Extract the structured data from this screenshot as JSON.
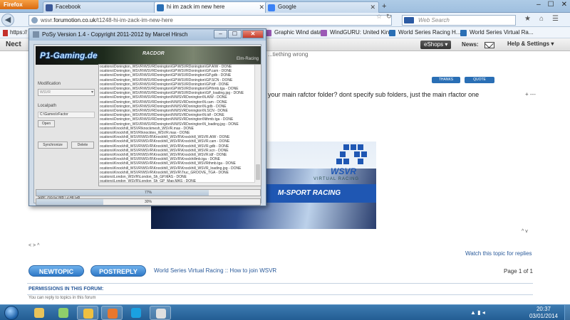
{
  "browser": {
    "app_button": "Firefox",
    "tabs": [
      {
        "label": "Facebook",
        "icon": "facebook-icon",
        "color": "#3b5998",
        "active": false
      },
      {
        "label": "hi im zack im new here",
        "icon": "wsvr-icon",
        "color": "#2a6fb5",
        "active": true
      },
      {
        "label": "Google",
        "icon": "google-icon",
        "color": "#3b82f6",
        "active": false
      }
    ],
    "new_tab": "+",
    "url": {
      "prefix": "wsvr.",
      "domain": "forumotion.co.uk",
      "path": "/t1248-hi-im-zack-im-new-here"
    },
    "search_placeholder": "Web Search",
    "bookmarks": [
      {
        "label": "https://",
        "color": "#c4302b"
      },
      {
        "label": "Graphic Wind data",
        "color": "#9b59b6"
      },
      {
        "label": "WindGURU: United Kin...",
        "color": "#9b59b6"
      },
      {
        "label": "World Series Racing H...",
        "color": "#2a6fb5"
      },
      {
        "label": "World Series Virtual Ra...",
        "color": "#2a6fb5"
      }
    ]
  },
  "site_toolbar": {
    "brand": "Nect",
    "eshops": "eShops ▾",
    "news": "News:",
    "help": "Help & Settings ▾"
  },
  "post": {
    "fragment": "...tiething wrong",
    "thanks": "THANKS",
    "quote": "QUOTE",
    "text": "your main rafctor folder? dont specify sub folders, just the main rfactor one",
    "side": "+ ---",
    "arrows": "^ v"
  },
  "banner": {
    "logo_text": "VIRTUAL RACING",
    "msport": "M-SPORT RACING"
  },
  "forum": {
    "left_arrows": "< > ^",
    "watch": "Watch this topic for replies",
    "newtopic": "NEWTOPIC",
    "postreply": "POSTREPLY",
    "breadcrumb": "World Series Virtual Racing :: How to join WSVR",
    "pagination": "Page 1 of 1",
    "perm_title": "PERMISSIONS IN THIS FORUM:",
    "perm_text": "You can reply to topics in this forum"
  },
  "posy": {
    "title": "PoSy Version 1.4 - Copyright 2011-2012 by Marcel Hirsch",
    "logo": "P1-Gaming.de",
    "racdor": "RACDOR",
    "elm": "Elm-Racing",
    "modification_label": "Modification",
    "modification_value": "WSVR",
    "localpath_label": "Localpath",
    "localpath_value": "C:\\Games\\rFactor",
    "open_button": "Open",
    "sync_button": "Synchronize",
    "delete_button": "Delete",
    "size_text": "Size: 765.62 MB \\ 2.48 GB",
    "progress1": {
      "value": 0.77,
      "label": "77%"
    },
    "progress2": {
      "value": 0.3,
      "label": "30%"
    },
    "log_lines": [
      "ocations\\Donington_WSVR\\WSVRDonington\\GP\\WSVRDonington\\GP.AIW - DONE",
      "ocations\\Donington_WSVR\\WSVRDonington\\GP\\WSVRDonington\\GP.cam - DONE",
      "ocations\\Donington_WSVR\\WSVRDonington\\GP\\WSVRDonington\\GP.gdb - DONE",
      "ocations\\Donington_WSVR\\WSVRDonington\\GP\\WSVRDonington\\GP.SCN - DONE",
      "ocations\\Donington_WSVR\\WSVRDonington\\GP\\WSVRDonington\\GP.tdf - DONE",
      "ocations\\Donington_WSVR\\WSVRDonington\\GP\\WSVRDonington\\GPthmb.tga - DONE",
      "ocations\\Donington_WSVR\\WSVRDonington\\GP\\WSVRDonington\\GP_loading.jpg - DONE",
      "ocations\\Donington_WSVR\\WSVRDonington\\N\\WSVRDonington\\N.AIW - DONE",
      "ocations\\Donington_WSVR\\WSVRDonington\\N\\WSVRDonington\\N.cam - DONE",
      "ocations\\Donington_WSVR\\WSVRDonington\\N\\WSVRDonington\\N.gdb - DONE",
      "ocations\\Donington_WSVR\\WSVRDonington\\N\\WSVRDonington\\N.SCN - DONE",
      "ocations\\Donington_WSVR\\WSVRDonington\\N\\WSVRDonington\\N.tdf - DONE",
      "ocations\\Donington_WSVR\\WSVRDonington\\N\\WSVRDonington\\Nthmb.tga - DONE",
      "ocations\\Donington_WSVR\\WSVRDonington\\N\\WSVRDonington\\N_loading.jpg - DONE",
      "ocations\\Knockhill_WSVR\\knockmesh_WSVR.mas - DONE",
      "ocations\\Knockhill_WSVR\\knocktex_WSVR.mas - DONE",
      "ocations\\Knockhill_WSVR\\WSVR\\Knockhill_WSVR\\Knockhill_WSVR.AIW - DONE",
      "ocations\\Knockhill_WSVR\\WSVR\\Knockhill_WSVR\\Knockhill_WSVR.cam - DONE",
      "ocations\\Knockhill_WSVR\\WSVR\\Knockhill_WSVR\\Knockhill_WSVR.gdb - DONE",
      "ocations\\Knockhill_WSVR\\WSVR\\Knockhill_WSVR\\Knockhill_WSVR.scn - DONE",
      "ocations\\Knockhill_WSVR\\WSVR\\Knockhill_WSVR\\Knockhill_WSVR.tdf - DONE",
      "ocations\\Knockhill_WSVR\\WSVR\\Knockhill_WSVR\\Knockhillmb.tga - DONE",
      "ocations\\Knockhill_WSVR\\WSVR\\Knockhill_WSVR\\Knockhill_WSVRthmb.tga - DONE",
      "ocations\\Knockhill_WSVR\\WSVR\\Knockhill_WSVR\\Knockhill_WSVR_loading.jpg - DONE",
      "ocations\\Knockhill_WSVR\\WSVR\\Knockhill_WSVR\\Truc_GROOVE_TGA - DONE",
      "ocations\\London_WSVR\\London_Sh_GP.MAS - DONE",
      "ocations\\London_WSVR\\London_Sh_GP_Map.MAS - DONE"
    ]
  },
  "taskbar": {
    "apps": [
      {
        "name": "explorer",
        "icon": "folder-icon",
        "color": "#e8c35a",
        "active": false
      },
      {
        "name": "notes",
        "icon": "notes-icon",
        "color": "#8fcf6b",
        "active": false
      },
      {
        "name": "explorer2",
        "icon": "folder-open-icon",
        "color": "#f0c040",
        "active": true
      },
      {
        "name": "firefox",
        "icon": "firefox-icon",
        "color": "#e8772e",
        "active": true
      },
      {
        "name": "skype",
        "icon": "skype-icon",
        "color": "#1aa1e1",
        "active": false
      },
      {
        "name": "java",
        "icon": "java-icon",
        "color": "#e0e0e0",
        "active": true
      }
    ],
    "tray": "▲ ▮ ◂",
    "time": "20:37",
    "date": "03/01/2014"
  }
}
